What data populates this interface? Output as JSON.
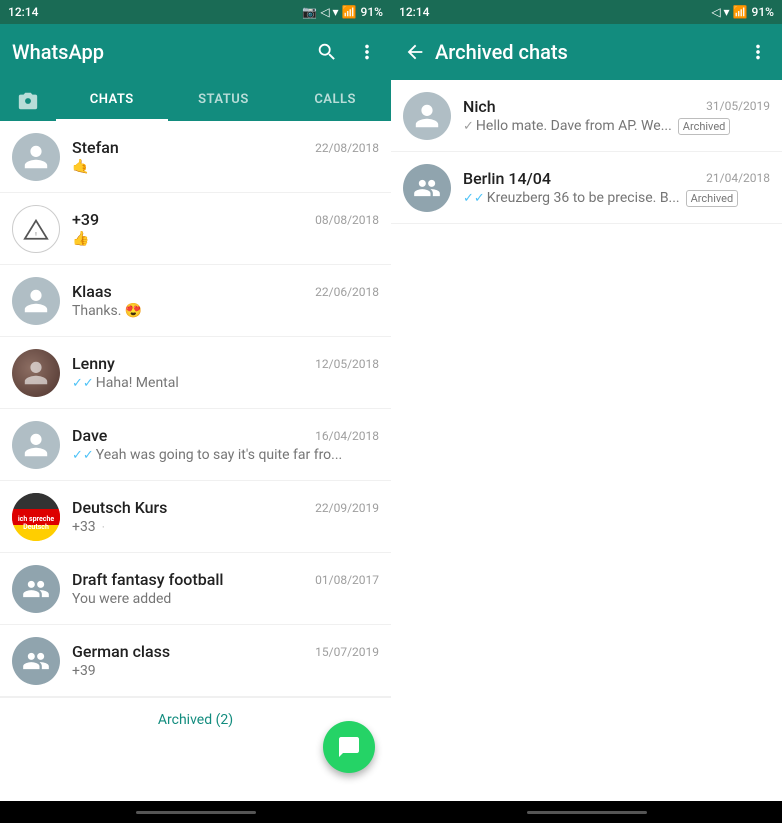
{
  "app": {
    "name": "WhatsApp",
    "status_bar_time": "12:14",
    "battery": "91%"
  },
  "left_panel": {
    "header": {
      "title": "WhatsApp",
      "search_label": "search",
      "menu_label": "more options"
    },
    "tabs": [
      {
        "id": "camera",
        "label": "📷",
        "type": "icon"
      },
      {
        "id": "chats",
        "label": "CHATS",
        "active": true
      },
      {
        "id": "status",
        "label": "STATUS"
      },
      {
        "id": "calls",
        "label": "CALLS"
      }
    ],
    "chats": [
      {
        "id": 1,
        "name": "Stefan",
        "date": "22/08/2018",
        "preview": "🤙",
        "avatar_type": "person"
      },
      {
        "id": 2,
        "name": "+39",
        "date": "08/08/2018",
        "preview": "👍",
        "avatar_type": "triangle"
      },
      {
        "id": 3,
        "name": "Klaas",
        "date": "22/06/2018",
        "preview": "Thanks. 😍",
        "avatar_type": "person"
      },
      {
        "id": 4,
        "name": "Lenny",
        "date": "12/05/2018",
        "preview": "Haha! Mental",
        "has_ticks": true,
        "avatar_type": "lenny"
      },
      {
        "id": 5,
        "name": "Dave",
        "date": "16/04/2018",
        "preview": "Yeah was going to say it's quite far fro...",
        "has_ticks": true,
        "avatar_type": "person"
      },
      {
        "id": 6,
        "name": "Deutsch Kurs",
        "date": "22/09/2019",
        "preview": "+33",
        "avatar_type": "deutsch",
        "has_dot": true
      },
      {
        "id": 7,
        "name": "Draft fantasy football",
        "date": "01/08/2017",
        "preview": "You were added",
        "avatar_type": "group"
      },
      {
        "id": 8,
        "name": "German class",
        "date": "15/07/2019",
        "preview": "+39",
        "avatar_type": "group"
      }
    ],
    "archived_footer": "Archived (2)"
  },
  "right_panel": {
    "header": {
      "title": "Archived chats",
      "back_label": "back",
      "menu_label": "more options"
    },
    "chats": [
      {
        "id": 1,
        "name": "Nich",
        "date": "31/05/2019",
        "preview": "Hello mate. Dave from AP. We...",
        "has_tick": true,
        "avatar_type": "person",
        "tag": "Archived"
      },
      {
        "id": 2,
        "name": "Berlin 14/04",
        "date": "21/04/2018",
        "preview": "Kreuzberg 36 to be precise. B...",
        "has_double_tick": true,
        "avatar_type": "group",
        "tag": "Archived"
      }
    ]
  }
}
